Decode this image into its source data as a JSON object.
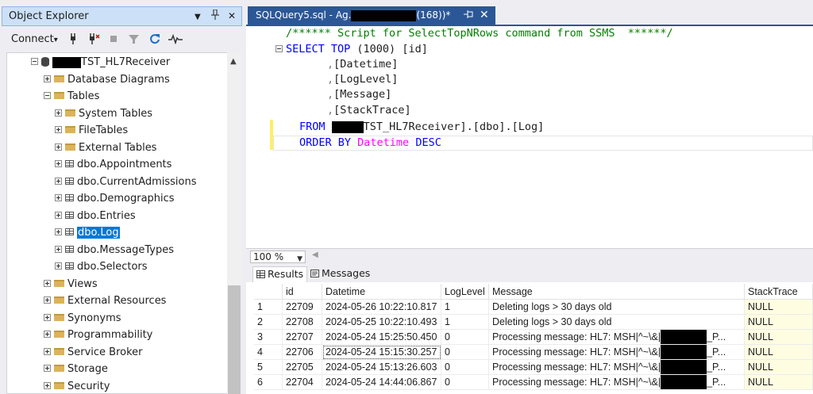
{
  "object_explorer": {
    "title": "Object Explorer",
    "pin_glyph": "▼",
    "dock_glyph": "⊥",
    "close_glyph": "✕",
    "connect_label": "Connect",
    "connect_arrow": "▾",
    "tree": [
      {
        "label": "TST_HL7Receiver",
        "icon": "database-icon",
        "expand": "minus",
        "redacted": true
      },
      {
        "label": "Database Diagrams",
        "icon": "folder-icon",
        "expand": "plus"
      },
      {
        "label": "Tables",
        "icon": "folder-icon",
        "expand": "minus"
      },
      {
        "label": "System Tables",
        "icon": "folder-icon",
        "expand": "plus"
      },
      {
        "label": "FileTables",
        "icon": "folder-icon",
        "expand": "plus"
      },
      {
        "label": "External Tables",
        "icon": "folder-icon",
        "expand": "plus"
      },
      {
        "label": "dbo.Appointments",
        "icon": "table-icon",
        "expand": "plus"
      },
      {
        "label": "dbo.CurrentAdmissions",
        "icon": "table-icon",
        "expand": "plus"
      },
      {
        "label": "dbo.Demographics",
        "icon": "table-icon",
        "expand": "plus"
      },
      {
        "label": "dbo.Entries",
        "icon": "table-icon",
        "expand": "plus"
      },
      {
        "label": "dbo.Log",
        "icon": "table-icon",
        "expand": "plus",
        "selected": true
      },
      {
        "label": "dbo.MessageTypes",
        "icon": "table-icon",
        "expand": "plus"
      },
      {
        "label": "dbo.Selectors",
        "icon": "table-icon",
        "expand": "plus"
      },
      {
        "label": "Views",
        "icon": "folder-icon",
        "expand": "plus"
      },
      {
        "label": "External Resources",
        "icon": "folder-icon",
        "expand": "plus"
      },
      {
        "label": "Synonyms",
        "icon": "folder-icon",
        "expand": "plus"
      },
      {
        "label": "Programmability",
        "icon": "folder-icon",
        "expand": "plus"
      },
      {
        "label": "Service Broker",
        "icon": "folder-icon",
        "expand": "plus"
      },
      {
        "label": "Storage",
        "icon": "folder-icon",
        "expand": "plus"
      },
      {
        "label": "Security",
        "icon": "folder-icon",
        "expand": "plus"
      }
    ]
  },
  "editor": {
    "tab": {
      "prefix": "SQLQuery5.sql - Ag.",
      "suffix": "(168))*",
      "pin_glyph": "⊸",
      "close_glyph": "✕"
    },
    "code": {
      "comment": "/****** Script for SelectTopNRows command from SSMS  ******/",
      "select_kw": "SELECT TOP ",
      "top_n": "(1000)",
      "col1": " [id]",
      "col2": "[Datetime]",
      "col3": "[LogLevel]",
      "col4": "[Message]",
      "col5": "[StackTrace]",
      "comma": ",",
      "from_kw": "FROM ",
      "from_rest": "TST_HL7Receiver].[dbo].[Log]",
      "order_kw": "ORDER BY",
      "order_col": " Datetime ",
      "desc_kw": "DESC"
    },
    "zoom": "100 %",
    "result_tabs": [
      {
        "label": "Results"
      },
      {
        "label": "Messages"
      }
    ]
  },
  "results": {
    "columns": [
      "id",
      "Datetime",
      "LogLevel",
      "Message",
      "StackTrace"
    ],
    "rows": [
      {
        "n": "1",
        "id": "22709",
        "dt": "2024-05-26 10:22:10.817",
        "lvl": "1",
        "msg": "Deleting logs > 30 days old",
        "st": "NULL"
      },
      {
        "n": "2",
        "id": "22708",
        "dt": "2024-05-25 10:22:10.493",
        "lvl": "1",
        "msg": "Deleting logs > 30 days old",
        "st": "NULL"
      },
      {
        "n": "3",
        "id": "22707",
        "dt": "2024-05-24 15:25:50.450",
        "lvl": "0",
        "msg": "Processing message:   HL7:  MSH|^~\\&|",
        "tail": "_P...",
        "st": "NULL"
      },
      {
        "n": "4",
        "id": "22706",
        "dt": "2024-05-24 15:15:30.257",
        "lvl": "0",
        "msg": "Processing message:   HL7:  MSH|^~\\&|",
        "tail": "_P...",
        "st": "NULL"
      },
      {
        "n": "5",
        "id": "22705",
        "dt": "2024-05-24 15:13:26.603",
        "lvl": "0",
        "msg": "Processing message:   HL7:  MSH|^~\\&|",
        "tail": "_P...",
        "st": "NULL"
      },
      {
        "n": "6",
        "id": "22704",
        "dt": "2024-05-24 14:44:06.867",
        "lvl": "0",
        "msg": "Processing message:   HL7:  MSH|^~\\&|",
        "tail": "_P...",
        "st": "NULL"
      }
    ]
  }
}
